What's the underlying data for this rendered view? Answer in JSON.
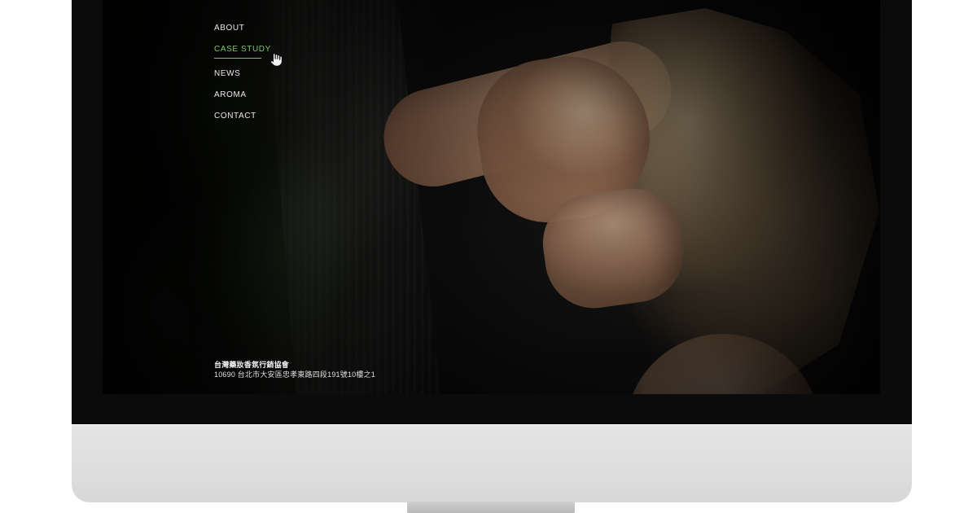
{
  "screen": {
    "nav": {
      "items": [
        {
          "label": "ABOUT",
          "active": false
        },
        {
          "label": "CASE STUDY",
          "active": true
        },
        {
          "label": "NEWS",
          "active": false
        },
        {
          "label": "AROMA",
          "active": false
        },
        {
          "label": "CONTACT",
          "active": false
        }
      ],
      "active_color": "#7fc66b",
      "text_color": "#e9e9e9"
    },
    "footer": {
      "line1": "台灣藥妝香氛行銷協會",
      "line2": "10690 台北市大安區忠孝東路四段191號10樓之1"
    }
  },
  "device": {
    "bezel_color": "#0b0b0b",
    "chin_color": "#d8d8d8"
  },
  "icons": {
    "cursor": "pointer-hand-icon"
  }
}
